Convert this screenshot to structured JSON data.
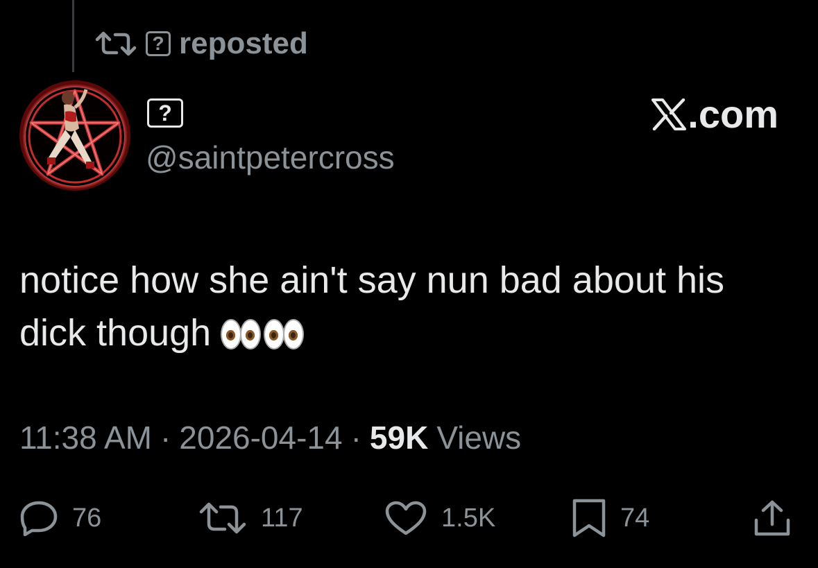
{
  "repost": {
    "label": "reposted",
    "unknown_glyph": "?"
  },
  "author": {
    "display_name_glyph": "?",
    "handle": "@saintpetercross",
    "avatar": "pentagram-figure-avatar"
  },
  "brand": {
    "text": ".com",
    "logo": "x-logo-icon"
  },
  "post": {
    "text": "notice how she ain't say nun bad about his dick though",
    "emoji": [
      "eyes-emoji",
      "eyes-emoji"
    ]
  },
  "meta": {
    "time": "11:38 AM",
    "separator": "·",
    "date": "2026-04-14",
    "views_count": "59K",
    "views_label": "Views"
  },
  "actions": {
    "replies": "76",
    "reposts": "117",
    "likes": "1.5K",
    "bookmarks": "74"
  },
  "colors": {
    "background": "#000000",
    "primary_text": "#e7e9ea",
    "secondary_text": "#8b9298",
    "avatar_accent": "#c42d2d"
  }
}
